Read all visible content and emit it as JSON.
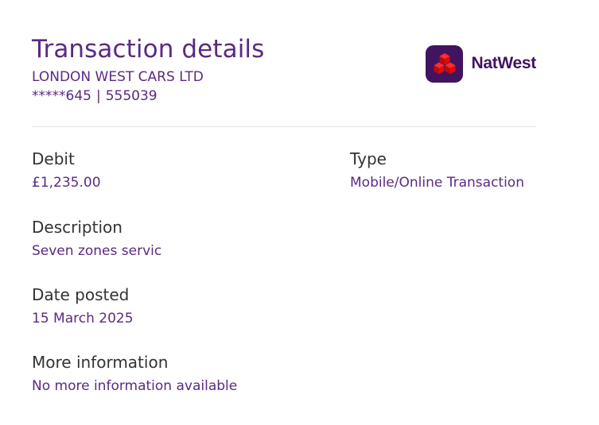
{
  "header": {
    "title": "Transaction details",
    "company": "LONDON WEST CARS LTD",
    "account_masked": "*****645",
    "separator": "|",
    "sort_code": "555039"
  },
  "brand": {
    "name": "NatWest",
    "logo_icon": "natwest-cubes-icon",
    "colors": {
      "primary": "#42145f",
      "accent": "#e10a0a"
    }
  },
  "details": {
    "debit": {
      "label": "Debit",
      "value": "£1,235.00"
    },
    "type": {
      "label": "Type",
      "value": "Mobile/Online Transaction"
    },
    "description": {
      "label": "Description",
      "value": "Seven zones servic"
    },
    "date_posted": {
      "label": "Date posted",
      "value": "15 March 2025"
    },
    "more_information": {
      "label": "More information",
      "value": "No more information available"
    }
  }
}
